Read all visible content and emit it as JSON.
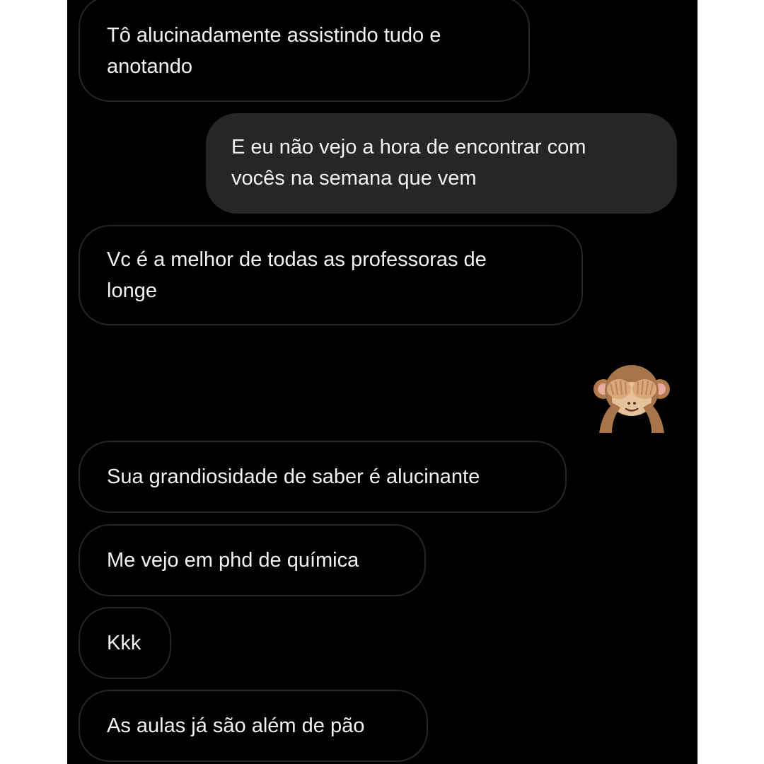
{
  "messages": [
    {
      "id": "m1",
      "direction": "received",
      "text": "Tô alucinadamente assistindo tudo e\nanotando"
    },
    {
      "id": "m2",
      "direction": "sent",
      "text": "E eu não vejo a hora de encontrar com\nvocês na semana que vem"
    },
    {
      "id": "m3",
      "direction": "received",
      "text": "Vc é a melhor de todas as professoras de\nlonge"
    },
    {
      "id": "m4",
      "direction": "sent-emoji",
      "icon": "see-no-evil-monkey-icon"
    },
    {
      "id": "m5",
      "direction": "received",
      "text": "Sua grandiosidade de saber é alucinante"
    },
    {
      "id": "m6",
      "direction": "received",
      "text": "Me vejo em phd de química"
    },
    {
      "id": "m7",
      "direction": "received",
      "text": "Kkk"
    },
    {
      "id": "m8",
      "direction": "received",
      "text": "As aulas já são além de pão"
    }
  ],
  "colors": {
    "background": "#000000",
    "sent_bubble": "#262626",
    "received_border": "#262626",
    "text": "#f2f2f2",
    "page_margin": "#ffffff"
  }
}
